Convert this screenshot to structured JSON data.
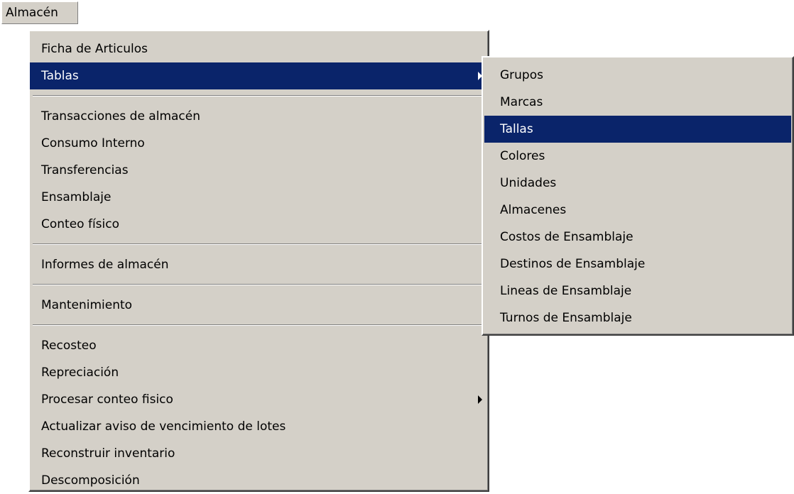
{
  "menubar": {
    "title": "Almacén"
  },
  "main_menu": {
    "ficha": "Ficha de Articulos",
    "tablas": "Tablas",
    "transacciones": "Transacciones de almacén",
    "consumo": "Consumo Interno",
    "transferencias": "Transferencias",
    "ensamblaje": "Ensamblaje",
    "conteo": "Conteo físico",
    "informes": "Informes de almacén",
    "mantenimiento": "Mantenimiento",
    "recosteo": "Recosteo",
    "repreciacion": "Repreciación",
    "procesar": "Procesar conteo fisico",
    "actualizar": "Actualizar aviso de vencimiento de lotes",
    "reconstruir": "Reconstruir inventario",
    "descomposicion": "Descomposición"
  },
  "sub_menu": {
    "grupos": "Grupos",
    "marcas": "Marcas",
    "tallas": "Tallas",
    "colores": "Colores",
    "unidades": "Unidades",
    "almacenes": "Almacenes",
    "costos": "Costos de Ensamblaje",
    "destinos": "Destinos de Ensamblaje",
    "lineas": "Lineas de Ensamblaje",
    "turnos": "Turnos de Ensamblaje"
  },
  "colors": {
    "menu_bg": "#d4d0c8",
    "highlight": "#0a246a"
  }
}
